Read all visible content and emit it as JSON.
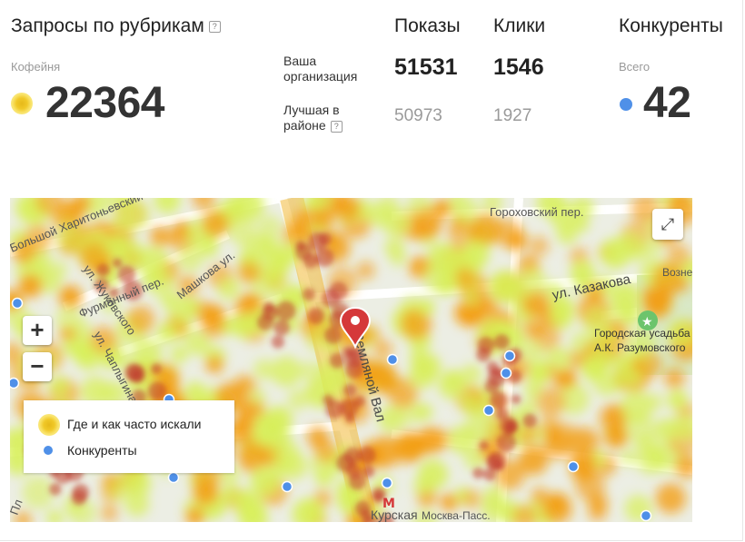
{
  "header": {
    "title": "Запросы по рубрикам",
    "help": "?",
    "category": "Кофейня",
    "requests_value": "22364"
  },
  "metrics": {
    "col_shows": "Показы",
    "col_clicks": "Клики",
    "rows": [
      {
        "label_line1": "Ваша",
        "label_line2": "организация",
        "shows": "51531",
        "clicks": "1546"
      },
      {
        "label_line1": "Лучшая в",
        "label_line2": "районе",
        "shows": "50973",
        "clicks": "1927"
      }
    ]
  },
  "competitors": {
    "title": "Конкуренты",
    "subtitle": "Всего",
    "value": "42"
  },
  "map": {
    "zoom_in": "+",
    "zoom_out": "−",
    "expand": "⤢",
    "legend": {
      "heat_label": "Где и как часто искали",
      "competitors_label": "Конкуренты"
    },
    "streets": [
      "Большой Харитоньевский",
      "Фурманный пер.",
      "Машкова ул.",
      "ул. Чаплыгина",
      "ул. Жуковского",
      "Земляной Вал",
      "Гороховский пер.",
      "ул. Казакова",
      "Возне",
      "Городская усадьба",
      "А.К. Разумовского",
      "Курская",
      "Москва-Пасс.",
      "Пл"
    ],
    "colors": {
      "heat_high": "#c0392b",
      "heat_mid": "#f39c12",
      "heat_low": "#d8ef5a",
      "competitor": "#4f90e8",
      "marker": "#d5383a"
    }
  }
}
